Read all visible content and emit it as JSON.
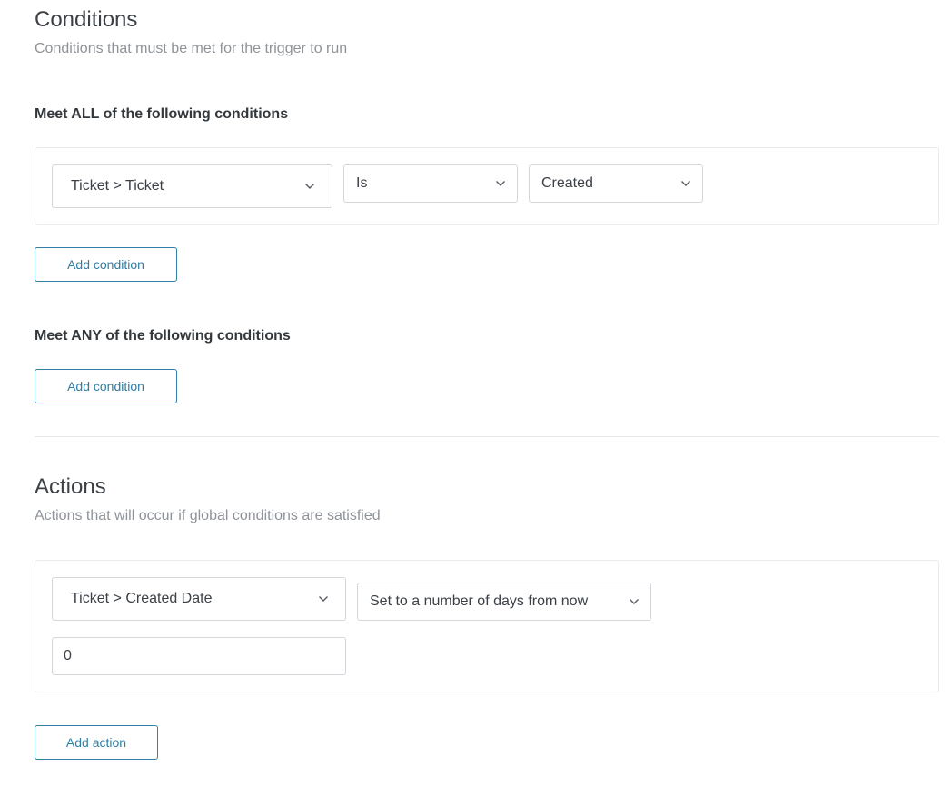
{
  "conditions": {
    "title": "Conditions",
    "subtitle": "Conditions that must be met for the trigger to run",
    "all_group": {
      "heading": "Meet ALL of the following conditions",
      "row": {
        "field": "Ticket > Ticket",
        "operator": "Is",
        "value": "Created"
      },
      "add_button": "Add condition"
    },
    "any_group": {
      "heading": "Meet ANY of the following conditions",
      "add_button": "Add condition"
    }
  },
  "actions": {
    "title": "Actions",
    "subtitle": "Actions that will occur if global conditions are satisfied",
    "row": {
      "field": "Ticket > Created Date",
      "operation": "Set to a number of days from now",
      "amount": "0"
    },
    "add_button": "Add action"
  },
  "icons": {
    "dropdown": "chevron-down-icon"
  },
  "colors": {
    "accent": "#2f7ea3",
    "border": "#d3d6da",
    "subtitle": "#8e9399"
  }
}
